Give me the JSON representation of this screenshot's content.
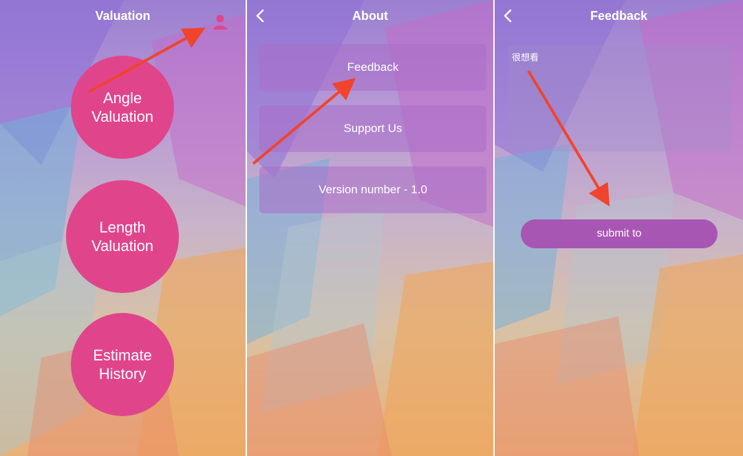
{
  "screen1": {
    "title": "Valuation",
    "buttons": [
      {
        "line1": "Angle",
        "line2": "Valuation"
      },
      {
        "line1": "Length",
        "line2": "Valuation"
      },
      {
        "line1": "Estimate",
        "line2": "History"
      }
    ],
    "user_icon": "user-icon"
  },
  "screen2": {
    "title": "About",
    "items": [
      {
        "label": "Feedback"
      },
      {
        "label": "Support Us"
      },
      {
        "label": "Version number - 1.0"
      }
    ]
  },
  "screen3": {
    "title": "Feedback",
    "textarea_value": "很想看",
    "submit_label": "submit to"
  },
  "colors": {
    "circle": "#e0458c",
    "submit": "#a856b4",
    "arrow": "#f0442c"
  }
}
